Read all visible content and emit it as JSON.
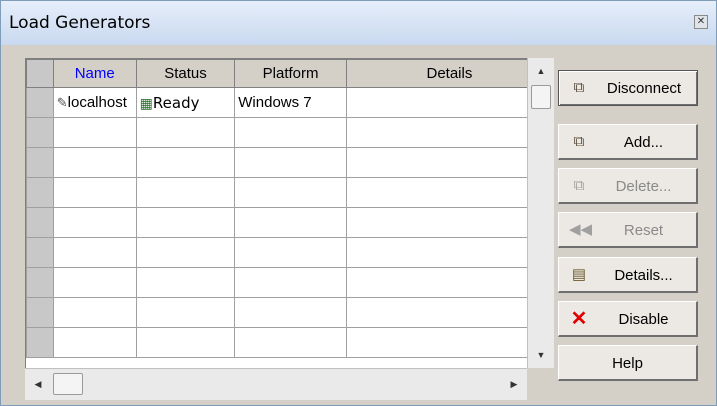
{
  "window": {
    "title": "Load Generators",
    "close_glyph": "✕"
  },
  "grid": {
    "columns": [
      "Name",
      "Status",
      "Platform",
      "Details"
    ],
    "rows": [
      {
        "name": "localhost",
        "status": "Ready",
        "platform": "Windows 7",
        "details": ""
      }
    ],
    "empty_rows": 8
  },
  "buttons": {
    "disconnect": "Disconnect",
    "add": "Add...",
    "delete": "Delete...",
    "reset": "Reset",
    "details": "Details...",
    "disable": "Disable",
    "help": "Help"
  },
  "icons": {
    "disconnect": "plug-disconnect-icon",
    "add": "plug-add-icon",
    "delete": "plug-delete-icon",
    "reset": "rewind-icon",
    "details": "clipboard-user-icon",
    "disable": "red-x-icon",
    "generator": "pencil-machine-icon",
    "status": "ready-check-icon"
  },
  "colors": {
    "accent": "#0000ff",
    "disable_red": "#e00000"
  }
}
